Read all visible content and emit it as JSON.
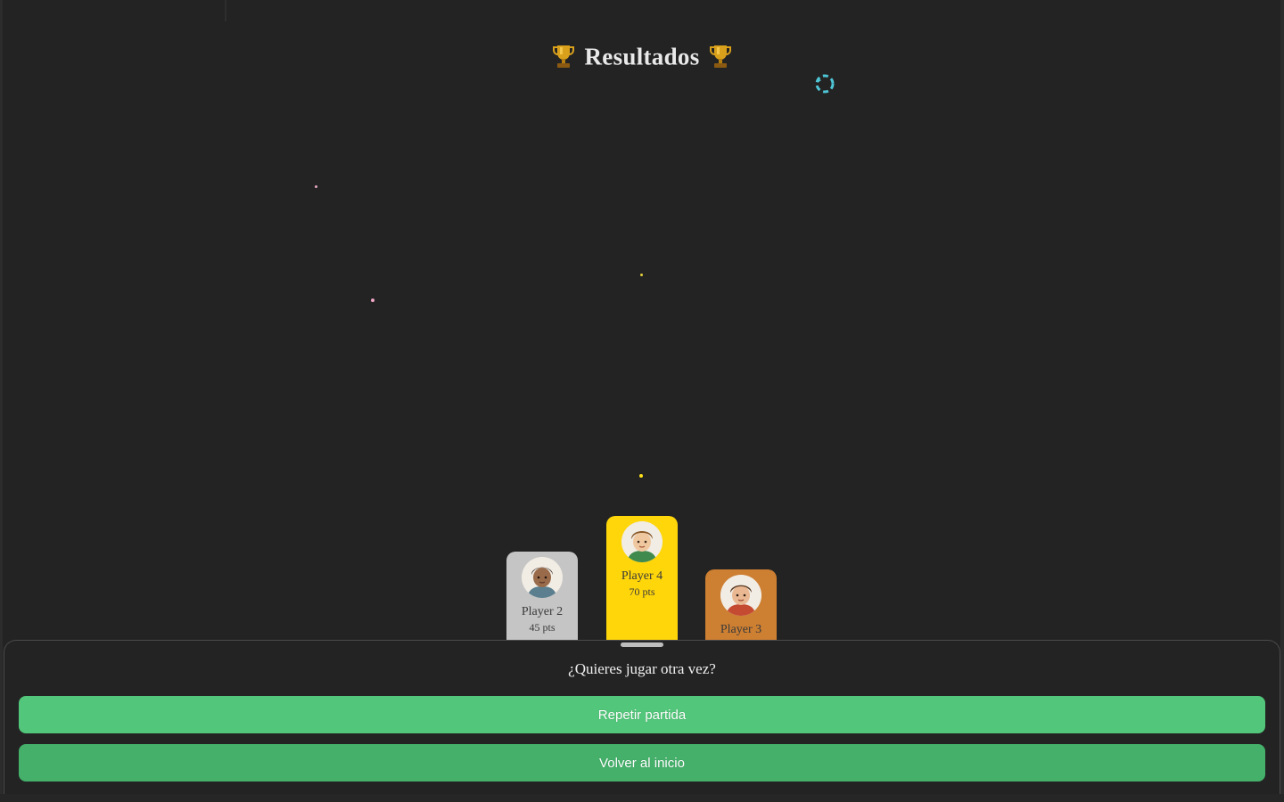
{
  "title": "Resultados",
  "colors": {
    "background": "#232323",
    "gold": "#ffd60a",
    "silver": "#c5c5c5",
    "bronze": "#cd7f32",
    "primary_button": "#52c67a",
    "secondary_button": "#44b06a"
  },
  "podium": {
    "first": {
      "name": "Player 4",
      "score": "70 pts",
      "place": 1
    },
    "second": {
      "name": "Player 2",
      "score": "45 pts",
      "place": 2
    },
    "third": {
      "name": "Player 3",
      "score": "",
      "place": 3
    }
  },
  "sheet": {
    "question": "¿Quieres jugar otra vez?",
    "repeat_label": "Repetir partida",
    "home_label": "Volver al inicio"
  },
  "icons": [
    "trophy-icon",
    "loading-spinner-icon",
    "avatar-icon"
  ]
}
